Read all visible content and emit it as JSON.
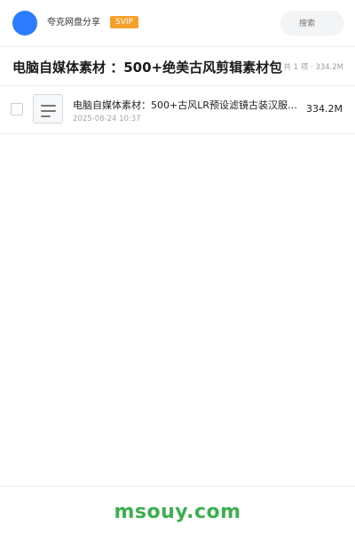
{
  "header": {
    "user_name": "夸克网盘分享",
    "vip_label": "SVIP",
    "search_placeholder": "搜索",
    "avatar_color": "#2a7bff"
  },
  "title_bar": {
    "title": "电脑自媒体素材 ：500+绝美古风剪辑素材包",
    "summary": "共 1 项 · 334.2M"
  },
  "files": [
    {
      "name": "电脑自媒体素材：500+古风LR预设滤镜古装汉服p…",
      "date": "2025-08-24 10:37",
      "size": "334.2M",
      "icon": "document-icon"
    }
  ],
  "footer": {
    "brand": "msouy.com",
    "brand_color": "#3caf4f"
  }
}
